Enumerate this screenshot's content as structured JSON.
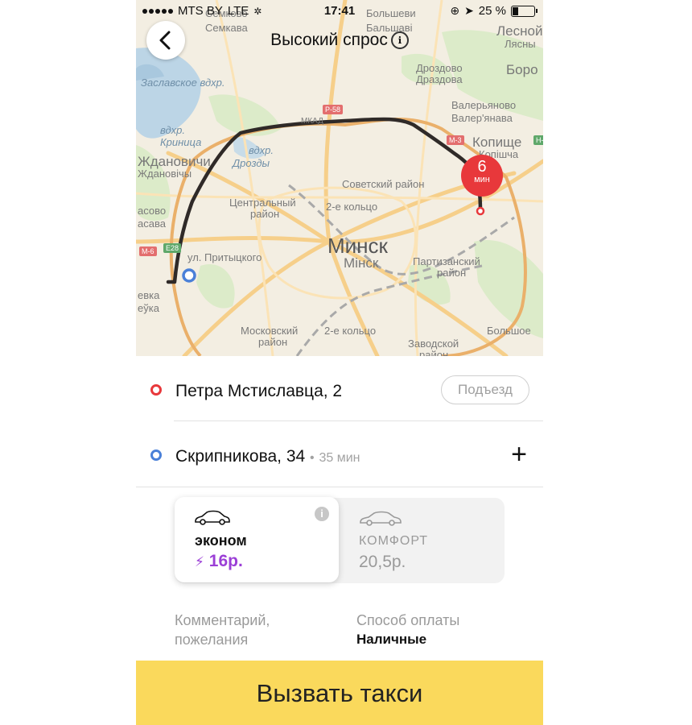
{
  "status_bar": {
    "carrier": "MTS BY",
    "network": "LTE",
    "time": "17:41",
    "battery": "25 %",
    "battery_level": 0.25
  },
  "header": {
    "title": "Высокий спрос",
    "info_icon": "ℹ"
  },
  "map": {
    "eta_value": "6",
    "eta_unit": "мин",
    "labels": {
      "city": "Минск",
      "city_by": "Мінск",
      "soviet": "Советский район",
      "central": "Центральный",
      "central2": "район",
      "partizan": "Партизанский",
      "partizan2": "район",
      "moscow": "Московский",
      "moscow2": "район",
      "zavod": "Заводской",
      "zavod2": "район",
      "ring2a": "2-е кольцо",
      "ring2b": "2-е кольцо",
      "zhdan": "Ждановичи",
      "zhdan_by": "Ждановічы",
      "pritytsky": "ул. Притыцкого",
      "drozdy_w": "вдхр.",
      "drozdy": "Дрозды",
      "krinitsa_w": "вдхр.",
      "krinitsa": "Криница",
      "reservoir": "Заславское вдхр.",
      "drozdovo": "Дроздово",
      "drozdovo_by": "Драздова",
      "valer": "Валерьяново",
      "valer_by": "Валер'янава",
      "kopishche": "Копище",
      "kopishche_by": "Копішча",
      "lesnoy": "Лесной",
      "lesnoy_by": "Лясны",
      "borov": "Боро",
      "semkovo": "Семково",
      "semkovo_by": "Семкава",
      "bolshev": "Большеви",
      "bolshev_by": "Бальшаві",
      "asovo": "асово",
      "asovo_by": "асава",
      "evka": "евка",
      "evka_by": "еўка",
      "bolshoe": "Большое",
      "mkad": "МКАД",
      "r58": "Р-58",
      "m3": "М-3",
      "m6": "М-6",
      "e28": "E28",
      "h": "Н-"
    }
  },
  "route": {
    "from": "Петра Мстиславца, 2",
    "porch_button": "Подъезд",
    "to": "Скрипникова, 34",
    "separator": "•",
    "to_time": "35 мин",
    "add_button": "+"
  },
  "tariffs": [
    {
      "name": "эконом",
      "price": "16р.",
      "surge_icon": "⚡",
      "selected": true,
      "info": "i"
    },
    {
      "name": "КОМФОРТ",
      "price": "20,5р.",
      "selected": false
    }
  ],
  "options": {
    "comment_line1": "Комментарий,",
    "comment_line2": "пожелания",
    "payment_label": "Способ оплаты",
    "payment_value": "Наличные"
  },
  "call_button": "Вызвать такси",
  "colors": {
    "accent": "#fad95c",
    "pickup_pin": "#e8383b",
    "destination_pin": "#4a80d8",
    "surge_price": "#9b3fd6"
  }
}
